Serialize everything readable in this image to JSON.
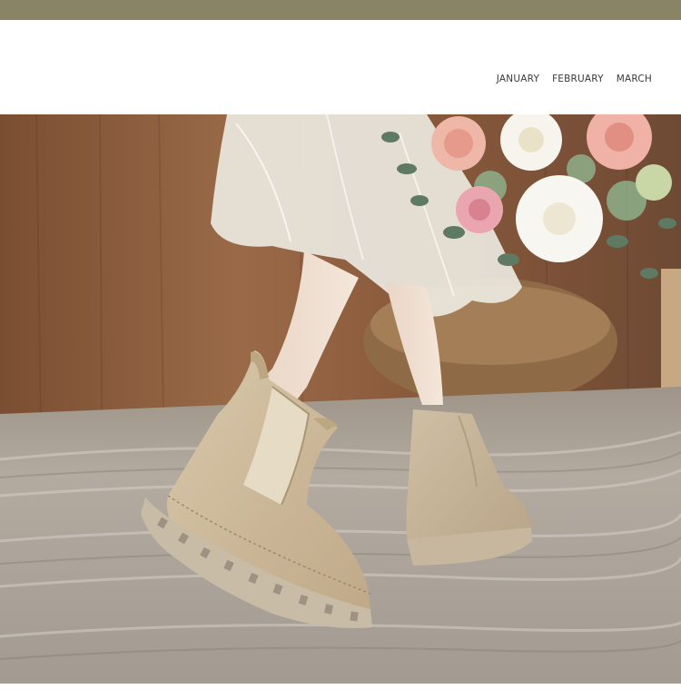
{
  "nav": {
    "items": [
      {
        "label": "JANUARY"
      },
      {
        "label": "FEBRUARY"
      },
      {
        "label": "MARCH"
      }
    ]
  },
  "colors": {
    "top_band": "#8a8466",
    "wood_wall": "#8a5a3a",
    "rug": "#b8b0a8",
    "boot_suede": "#cdbb9e",
    "boot_sole": "#c8bca6",
    "skirt": "#ece8df"
  },
  "icons": [
    "product-photo"
  ]
}
